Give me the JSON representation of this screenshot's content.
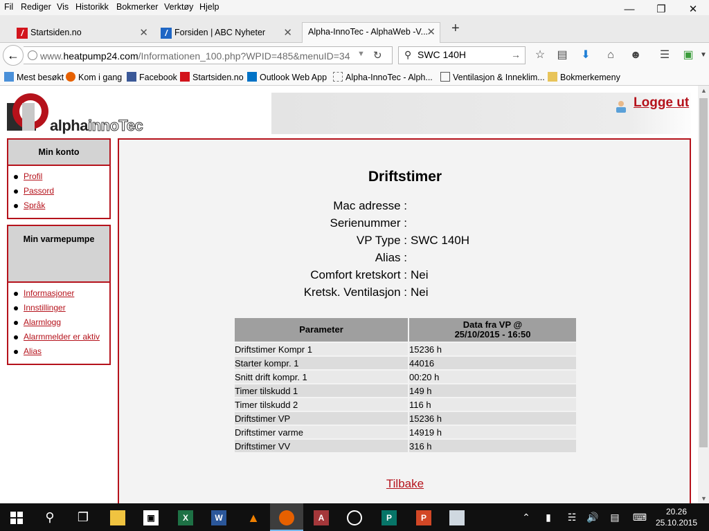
{
  "menubar": {
    "items": [
      "Fil",
      "Rediger",
      "Vis",
      "Historikk",
      "Bokmerker",
      "Verktøy",
      "Hjelp"
    ],
    "underline": [
      "F",
      "R",
      "V",
      "H",
      "B",
      "k",
      "H"
    ]
  },
  "tabs": [
    {
      "title": "Startsiden.no",
      "icon": "startsiden-icon"
    },
    {
      "title": "Forsiden | ABC Nyheter",
      "icon": "abc-icon"
    },
    {
      "title": "Alpha-InnoTec - AlphaWeb -V...",
      "icon": "none"
    }
  ],
  "navbar": {
    "url_prefix": "www.",
    "url_domain": "heatpump24.com",
    "url_path": "/Informationen_100.php?WPID=485&menuID=34",
    "search_value": "SWC 140H"
  },
  "bookmarks": [
    {
      "label": "Mest besøkt",
      "icon": "most-visited-icon"
    },
    {
      "label": "Kom i gang",
      "icon": "firefox-icon"
    },
    {
      "label": "Facebook",
      "icon": "facebook-icon"
    },
    {
      "label": "Startsiden.no",
      "icon": "startsiden-icon"
    },
    {
      "label": "Outlook Web App",
      "icon": "outlook-icon"
    },
    {
      "label": "Alpha-InnoTec - Alph...",
      "icon": "page-icon"
    },
    {
      "label": "Ventilasjon & Inneklim...",
      "icon": "home-icon"
    },
    {
      "label": "Bokmerkemeny",
      "icon": "folder-icon"
    }
  ],
  "header": {
    "logo_part1": "alpha",
    "logo_part2": "innoTec",
    "logout": "Logge ut"
  },
  "sidebar": {
    "account_title": "Min konto",
    "account_items": [
      "Profil",
      "Passord",
      "Språk"
    ],
    "pump_title": "Min varmepumpe",
    "pump_items": [
      "Informasjoner",
      "Innstillinger",
      "Alarmlogg",
      "Alarmmelder er aktiv",
      "Alias"
    ]
  },
  "main": {
    "title": "Driftstimer",
    "info": [
      {
        "label": "Mac adresse :",
        "value": ""
      },
      {
        "label": "Serienummer :",
        "value": ""
      },
      {
        "label": "VP Type :",
        "value": "SWC 140H"
      },
      {
        "label": "Alias :",
        "value": ""
      },
      {
        "label": "Comfort kretskort :",
        "value": "Nei"
      },
      {
        "label": "Kretsk. Ventilasjon :",
        "value": "Nei"
      }
    ],
    "table": {
      "col1": "Parameter",
      "col2_line1": "Data fra VP @",
      "col2_line2": "25/10/2015 - 16:50",
      "rows": [
        [
          "Driftstimer Kompr 1",
          "15236 h"
        ],
        [
          "Starter kompr. 1",
          "44016"
        ],
        [
          "Snitt drift kompr. 1",
          "00:20 h"
        ],
        [
          "Timer tilskudd 1",
          "149 h"
        ],
        [
          "Timer tilskudd 2",
          "116 h"
        ],
        [
          "Driftstimer VP",
          "15236 h"
        ],
        [
          "Driftstimer varme",
          "14919 h"
        ],
        [
          "Driftstimer VV",
          "316 h"
        ]
      ]
    },
    "back": "Tilbake"
  },
  "taskbar": {
    "time": "20.26",
    "date": "25.10.2015"
  },
  "colors": {
    "accent": "#b5121b",
    "header_gray": "#9f9f9f",
    "row_light": "#e9e9e9",
    "row_dark": "#dcdcdc"
  }
}
